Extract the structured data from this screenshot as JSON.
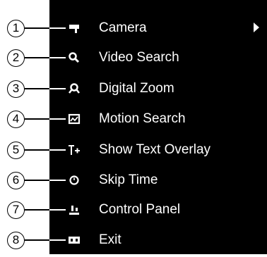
{
  "menu": {
    "items": [
      {
        "label": "Camera",
        "icon": "camera-icon",
        "callout": "1",
        "has_submenu": true
      },
      {
        "label": "Video Search",
        "icon": "search-icon",
        "callout": "2"
      },
      {
        "label": "Digital Zoom",
        "icon": "zoom-icon",
        "callout": "3"
      },
      {
        "label": "Motion Search",
        "icon": "motion-search-icon",
        "callout": "4"
      },
      {
        "label": "Show Text Overlay",
        "icon": "text-overlay-icon",
        "callout": "5"
      },
      {
        "label": "Skip Time",
        "icon": "clock-icon",
        "callout": "6"
      },
      {
        "label": "Control Panel",
        "icon": "control-panel-icon",
        "callout": "7"
      },
      {
        "label": "Exit",
        "icon": "exit-icon",
        "callout": "8"
      }
    ]
  },
  "colors": {
    "menu_bg": "#000000",
    "text": "#ffffff",
    "callout_line": "#000000"
  }
}
